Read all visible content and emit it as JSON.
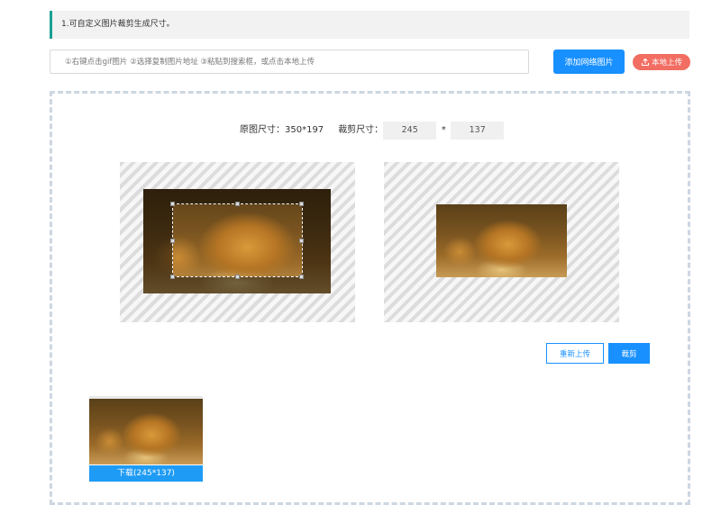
{
  "notice": {
    "text": "1.可自定义图片裁剪生成尺寸。"
  },
  "url_input": {
    "placeholder": "①右键点击gif图片 ②选择复制图片地址 ③粘贴到搜索框，或点击本地上传",
    "value": ""
  },
  "buttons": {
    "add_network_image": "添加网络图片",
    "local_upload": "本地上传",
    "reupload": "重新上传",
    "crop": "裁剪"
  },
  "size_info": {
    "original_label": "原图尺寸：350*197",
    "crop_label": "裁剪尺寸：",
    "crop_width": "245",
    "separator": "*",
    "crop_height": "137"
  },
  "result": {
    "download_label": "下载(245*137)"
  },
  "icons": {
    "upload": "upload-icon"
  },
  "colors": {
    "primary": "#1890ff",
    "upload_red": "#f26d62",
    "accent_bar": "#1aa094"
  }
}
